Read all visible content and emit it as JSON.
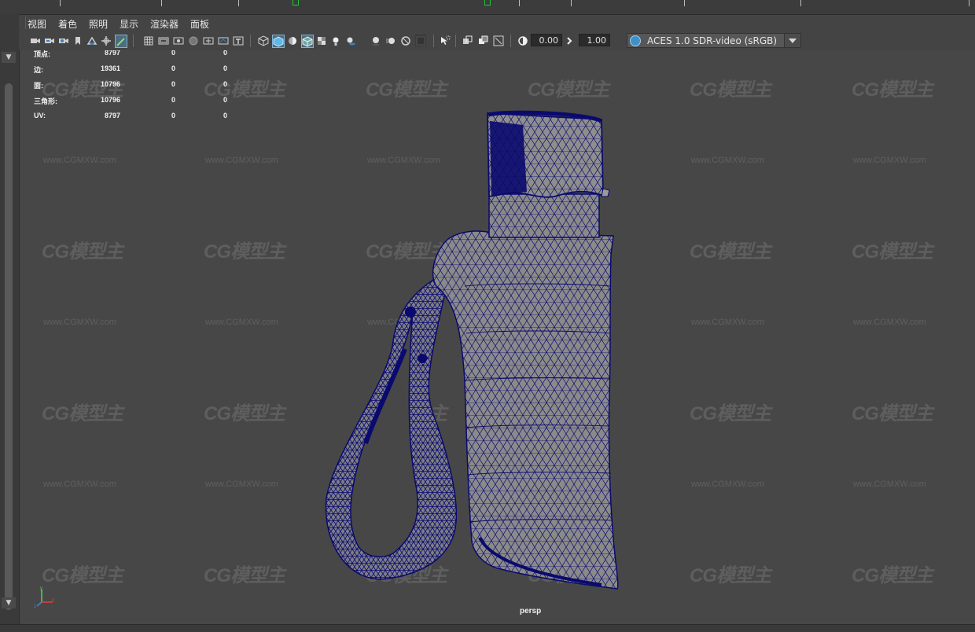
{
  "menubar": {
    "items": [
      "视图",
      "着色",
      "照明",
      "显示",
      "渲染器",
      "面板"
    ]
  },
  "toolbar": {
    "icons_group1": [
      "camera-icon",
      "camera-attributes-icon",
      "bookmark-icon",
      "image-plane-icon",
      "2d-pan-zoom-icon",
      "grease-pencil-icon"
    ],
    "icons_group2": [
      "grid-icon",
      "film-gate-icon",
      "resolution-gate-icon",
      "gate-mask-icon",
      "field-chart-icon",
      "safe-action-icon",
      "safe-title-icon"
    ],
    "icons_group3": [
      "wireframe-icon",
      "smooth-shade-icon",
      "use-default-material-icon",
      "wireframe-on-shaded-icon",
      "textured-icon",
      "lights-icon",
      "shadows-icon",
      "screen-space-ao-icon",
      "motion-blur-icon",
      "multisample-aa-icon",
      "depth-of-field-icon"
    ],
    "icons_group4": [
      "isolate-select-icon",
      "xray-icon",
      "xray-active-icon",
      "xray-joints-icon"
    ],
    "exposure_value": "0.00",
    "gamma_value": "1.00",
    "color_space": "ACES 1.0 SDR-video (sRGB)"
  },
  "hud": {
    "rows": [
      {
        "label": "顶点:",
        "v1": "8797",
        "v2": "0",
        "v3": "0"
      },
      {
        "label": "边:",
        "v1": "19361",
        "v2": "0",
        "v3": "0"
      },
      {
        "label": "面:",
        "v1": "10796",
        "v2": "0",
        "v3": "0"
      },
      {
        "label": "三角形:",
        "v1": "10796",
        "v2": "0",
        "v3": "0"
      },
      {
        "label": "UV:",
        "v1": "8797",
        "v2": "0",
        "v3": "0"
      }
    ]
  },
  "viewport": {
    "camera_label": "persp",
    "watermark_logo": "CG模型主",
    "watermark_url": "www.CGMXW.com",
    "background_color": "#474747",
    "wire_color": "#0a0a6e",
    "mesh_shade_color": "#8a8a8a"
  },
  "axis": {
    "x": "x",
    "y": "y",
    "z": "z"
  }
}
